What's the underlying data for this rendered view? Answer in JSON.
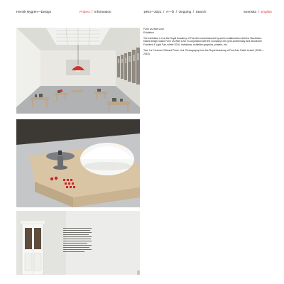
{
  "nav": {
    "brand": "Henrik Nygren—Design",
    "project": "Project",
    "sep1": "/",
    "information": "Information",
    "years": "1991—2021",
    "sep2": "/",
    "a_o": "A—Ö",
    "sep3": "/",
    "ongoing": "Ongoing",
    "sep4": "/",
    "search": "Search",
    "svenska": "Svenska",
    "sep5": "/",
    "english": "English"
  },
  "project": {
    "title": "Form Us With Love",
    "subtitle": "Exhibition",
    "description": "The exhibition I–X at the Royal Academy of Fine Arts commissioned by and in collaboration with the Stockholm-based design studio Form Us With Love in conjunction with the company's ten-year-anniversary and Stockholm Furniture & Light Fair, winter 2016. Invitations, exhibition graphics, posters, etc.",
    "credits": "Text: Liz Forslund, Richard Prime et al. Photography from the Royal Academy of Fine Arts: Patrik Lindell. (2015—2016)"
  },
  "images": [
    {
      "icon": "exhibition-hall-photo"
    },
    {
      "icon": "table-with-dome-lamp-photo"
    },
    {
      "icon": "white-door-with-wall-text-photo"
    }
  ],
  "colors": {
    "accent": "#d8322a",
    "text": "#1a1a1a",
    "background": "#ffffff"
  }
}
